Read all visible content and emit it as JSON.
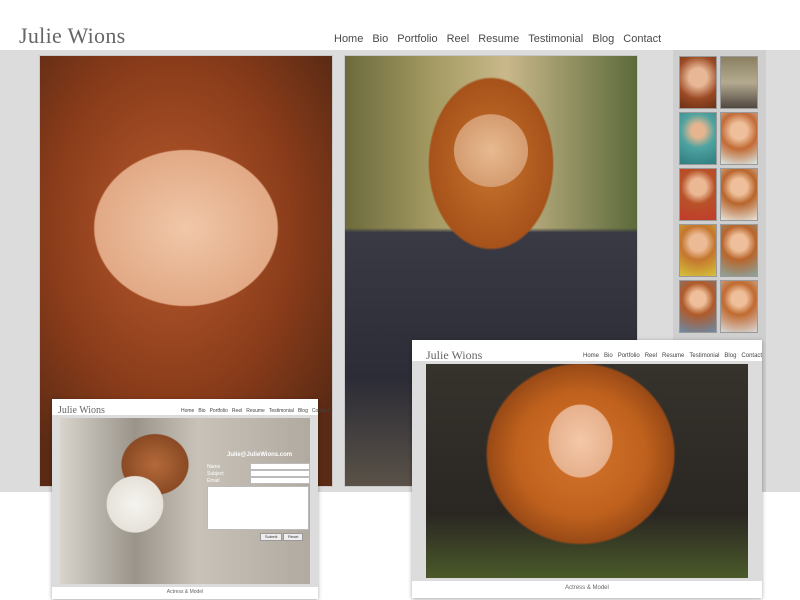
{
  "site": {
    "logo": "Julie Wions",
    "nav": [
      "Home",
      "Bio",
      "Portfolio",
      "Reel",
      "Resume",
      "Testimonial",
      "Blog",
      "Contact"
    ]
  },
  "gallery": {
    "thumb_count": 10
  },
  "screenshot_contact": {
    "logo": "Julie Wions",
    "nav": [
      "Home",
      "Bio",
      "Portfolio",
      "Reel",
      "Resume",
      "Testimonial",
      "Blog",
      "Contact"
    ],
    "email": "Julie@JulieWions.com",
    "labels": {
      "name": "Name",
      "subject": "Subject",
      "email": "Email"
    },
    "buttons": {
      "submit": "Submit",
      "reset": "Reset"
    },
    "footer": "Actress & Model"
  },
  "screenshot_home": {
    "logo": "Julie Wions",
    "nav": [
      "Home",
      "Bio",
      "Portfolio",
      "Reel",
      "Resume",
      "Testimonial",
      "Blog",
      "Contact"
    ],
    "footer": "Actress & Model"
  },
  "colors": {
    "stage_gray": "#dcdcdc",
    "logo_text": "#666666",
    "nav_text": "#4a4a4a"
  }
}
